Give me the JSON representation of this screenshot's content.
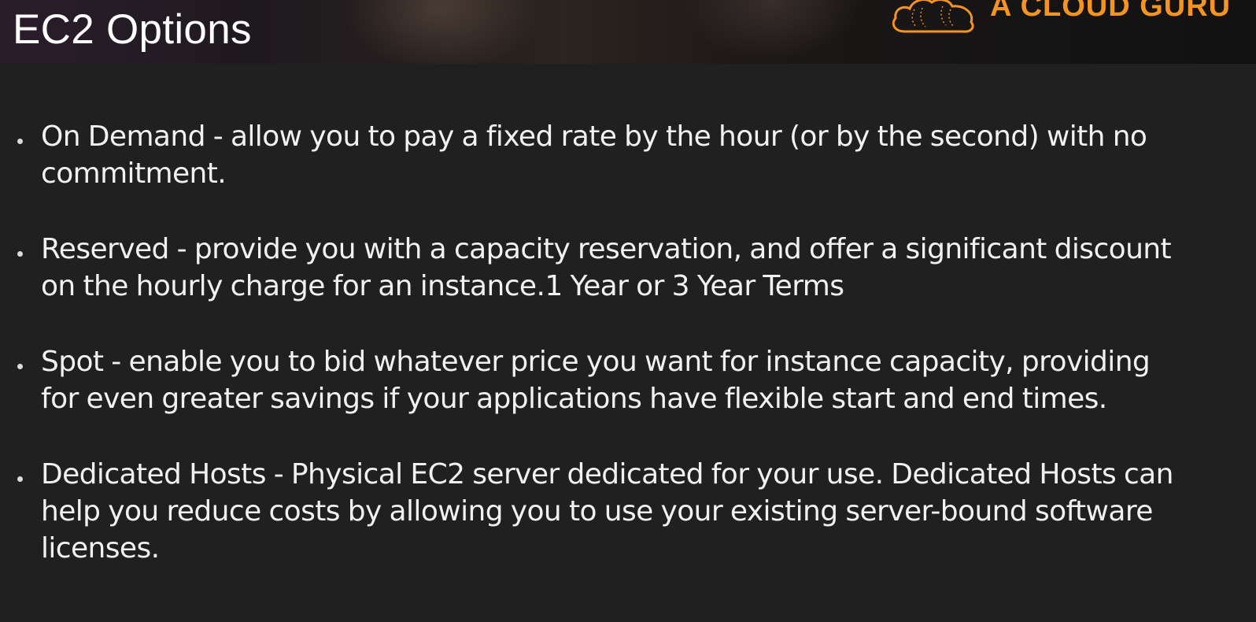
{
  "header": {
    "title": "EC2 Options",
    "brand_name": "A CLOUD GURU",
    "brand_icon": "cloud-logo-icon",
    "brand_color": "#f7941d"
  },
  "options": [
    {
      "text": "On Demand - allow you to pay a fixed rate by the hour (or by the second) with no commitment."
    },
    {
      "text": "Reserved - provide you with a capacity reservation, and offer a significant discount on the hourly charge for an instance.1 Year or 3 Year Terms"
    },
    {
      "text": "Spot - enable you to bid whatever price you want for instance capacity, providing for even greater savings if your applications have flexible start and end times."
    },
    {
      "text": "Dedicated Hosts - Physical EC2 server dedicated for your use. Dedicated Hosts can help you reduce costs by allowing you to use your existing server-bound software licenses."
    }
  ],
  "colors": {
    "background": "#202020",
    "text": "#f1f1f1"
  }
}
